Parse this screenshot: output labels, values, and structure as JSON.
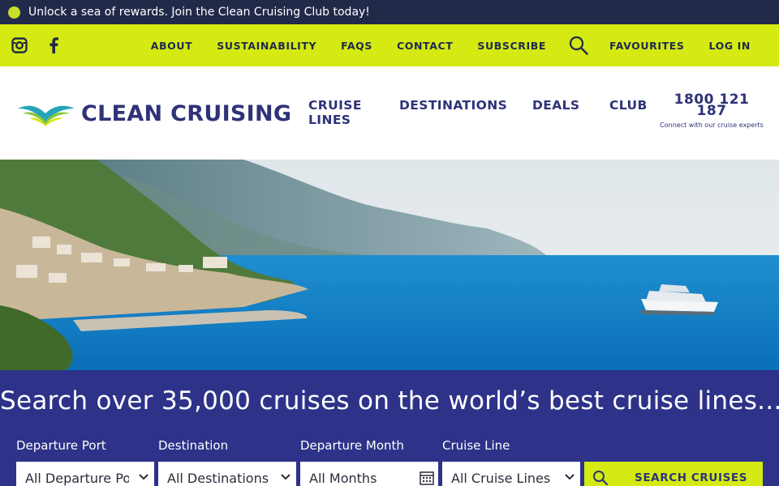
{
  "announcement": {
    "text": "Unlock a sea of rewards. Join the Clean Cruising Club today!"
  },
  "utility_nav": {
    "social": [
      "instagram-icon",
      "facebook-icon"
    ],
    "links": {
      "about": "ABOUT",
      "sustainability": "SUSTAINABILITY",
      "faqs": "FAQS",
      "contact": "CONTACT",
      "subscribe": "SUBSCRIBE",
      "favourites": "FAVOURITES",
      "login": "LOG IN"
    }
  },
  "brand": {
    "name": "CLEAN CRUISING",
    "colors": {
      "navy": "#2e3378",
      "lime": "#d4ea12",
      "dark": "#222a4a"
    }
  },
  "main_nav": {
    "cruise_lines": "CRUISE LINES",
    "destinations": "DESTINATIONS",
    "deals": "DEALS",
    "club": "CLUB",
    "phone": "1800 121 187",
    "phone_caption": "Connect with our cruise experts"
  },
  "search": {
    "title": "Search over 35,000 cruises on the world’s best cruise lines...",
    "fields": {
      "departure_port": {
        "label": "Departure Port",
        "value": "All Departure Ports"
      },
      "destination": {
        "label": "Destination",
        "value": "All Destinations"
      },
      "departure_month": {
        "label": "Departure Month",
        "value": "All Months"
      },
      "cruise_line": {
        "label": "Cruise Line",
        "value": "All Cruise Lines"
      }
    },
    "button": "SEARCH CRUISES"
  }
}
